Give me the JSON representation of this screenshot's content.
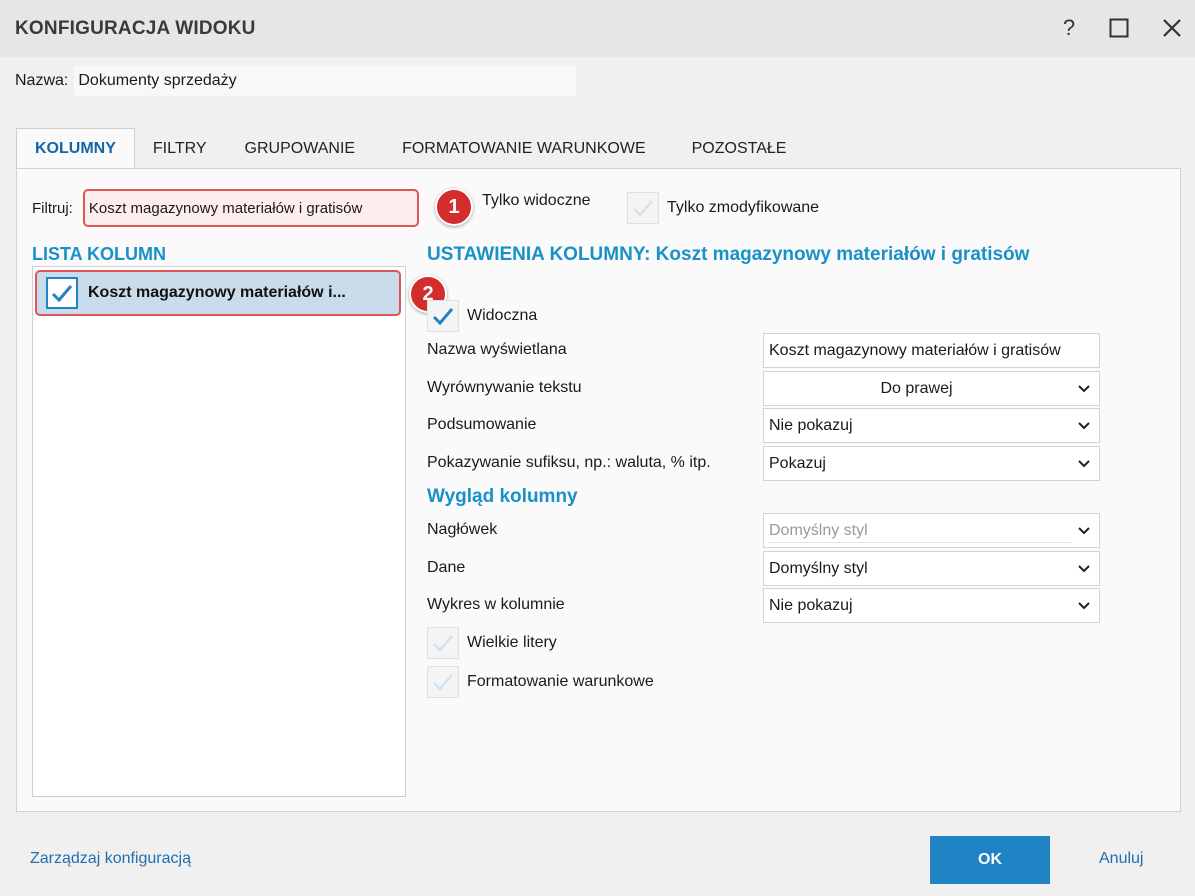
{
  "window": {
    "title": "KONFIGURACJA WIDOKU",
    "help_icon": "question-icon",
    "maximize_icon": "maximize-icon",
    "close_icon": "close-icon"
  },
  "name": {
    "label": "Nazwa:",
    "value": "Dokumenty sprzedaży"
  },
  "tabs": [
    {
      "label": "KOLUMNY",
      "active": true
    },
    {
      "label": "FILTRY",
      "active": false
    },
    {
      "label": "GRUPOWANIE",
      "active": false
    },
    {
      "label": "FORMATOWANIE WARUNKOWE",
      "active": false
    },
    {
      "label": "POZOSTAŁE",
      "active": false
    }
  ],
  "filter": {
    "label": "Filtruj:",
    "value": "Koszt magazynowy materiałów i gratisów",
    "only_visible_label": "Tylko widoczne",
    "only_visible_checked": false,
    "only_modified_label": "Tylko zmodyfikowane",
    "only_modified_checked": false
  },
  "badges": {
    "one": "1",
    "two": "2"
  },
  "column_list": {
    "title": "LISTA KOLUMN",
    "items": [
      {
        "label": "Koszt magazynowy materiałów i...",
        "checked": true,
        "selected": true
      }
    ]
  },
  "settings": {
    "title": "USTAWIENIA KOLUMNY: Koszt magazynowy materiałów i gratisów",
    "visible_label": "Widoczna",
    "visible_checked": true,
    "display_name_label": "Nazwa wyświetlana",
    "display_name_value": "Koszt magazynowy materiałów i gratisów",
    "text_align_label": "Wyrównywanie tekstu",
    "text_align_value": "Do prawej",
    "summary_label": "Podsumowanie",
    "summary_value": "Nie pokazuj",
    "suffix_label": "Pokazywanie sufiksu, np.: waluta, % itp.",
    "suffix_value": "Pokazuj"
  },
  "appearance": {
    "title": "Wygląd kolumny",
    "header_label": "Nagłówek",
    "header_value": "Domyślny styl",
    "data_label": "Dane",
    "data_value": "Domyślny styl",
    "chart_label": "Wykres w kolumnie",
    "chart_value": "Nie pokazuj",
    "uppercase_label": "Wielkie litery",
    "uppercase_checked": false,
    "conditional_label": "Formatowanie warunkowe",
    "conditional_checked": false
  },
  "footer": {
    "manage_link": "Zarządzaj konfiguracją",
    "ok_label": "OK",
    "cancel_label": "Anuluj"
  },
  "colors": {
    "accent": "#1f83c4",
    "heading": "#1991c8",
    "highlight": "#e05656",
    "badge": "#d32d2d"
  }
}
